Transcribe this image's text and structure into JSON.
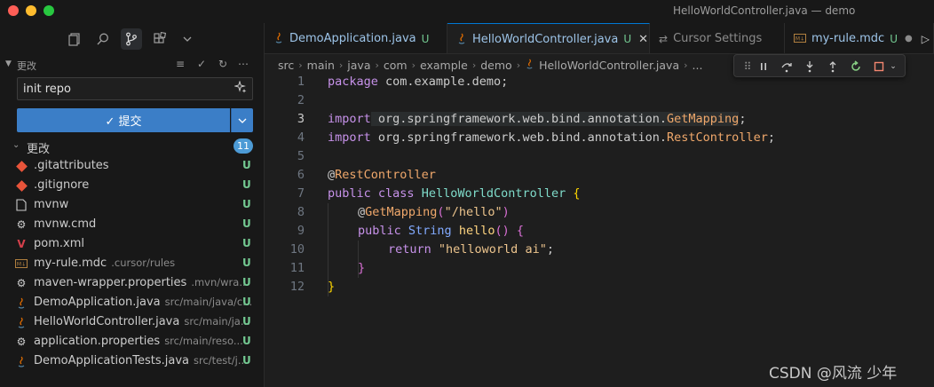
{
  "window": {
    "title": "HelloWorldController.java — demo"
  },
  "sidebar": {
    "section_title": "更改",
    "commit_message": "init repo",
    "commit_button": "✓ 提交",
    "changes_title": "更改",
    "changes_count": "11",
    "files": [
      {
        "name": ".gitattributes",
        "path": "",
        "status": "U",
        "icon": "git-icon"
      },
      {
        "name": ".gitignore",
        "path": "",
        "status": "U",
        "icon": "git-icon"
      },
      {
        "name": "mvnw",
        "path": "",
        "status": "U",
        "icon": "file-icon"
      },
      {
        "name": "mvnw.cmd",
        "path": "",
        "status": "U",
        "icon": "gear-icon"
      },
      {
        "name": "pom.xml",
        "path": "",
        "status": "U",
        "icon": "maven-icon"
      },
      {
        "name": "my-rule.mdc",
        "path": ".cursor/rules",
        "status": "U",
        "icon": "markdown-icon"
      },
      {
        "name": "maven-wrapper.properties",
        "path": ".mvn/wra...",
        "status": "U",
        "icon": "gear-icon"
      },
      {
        "name": "DemoApplication.java",
        "path": "src/main/java/c...",
        "status": "U",
        "icon": "java-icon"
      },
      {
        "name": "HelloWorldController.java",
        "path": "src/main/ja...",
        "status": "U",
        "icon": "java-icon"
      },
      {
        "name": "application.properties",
        "path": "src/main/reso...",
        "status": "U",
        "icon": "gear-icon"
      },
      {
        "name": "DemoApplicationTests.java",
        "path": "src/test/j...",
        "status": "U",
        "icon": "java-icon"
      }
    ]
  },
  "tabs": [
    {
      "label": "DemoApplication.java",
      "flag": "U",
      "icon": "java-icon"
    },
    {
      "label": "HelloWorldController.java",
      "flag": "U",
      "icon": "java-icon",
      "close": "✕"
    },
    {
      "label": "Cursor Settings",
      "flag": "",
      "icon": "settings-icon"
    },
    {
      "label": "my-rule.mdc",
      "flag": "U",
      "icon": "markdown-icon",
      "dot": "●"
    }
  ],
  "breadcrumb": [
    "src",
    "main",
    "java",
    "com",
    "example",
    "demo",
    "HelloWorldController.java",
    "..."
  ],
  "editor": {
    "lines": [
      {
        "n": "1"
      },
      {
        "n": "2"
      },
      {
        "n": "3"
      },
      {
        "n": "4"
      },
      {
        "n": "5"
      },
      {
        "n": "6"
      },
      {
        "n": "7"
      },
      {
        "n": "8"
      },
      {
        "n": "9"
      },
      {
        "n": "10"
      },
      {
        "n": "11"
      },
      {
        "n": "12"
      }
    ],
    "code": {
      "l1_kw": "package",
      "l1_rest": " com.example.demo;",
      "l3_kw": "import",
      "l3_pkg": " org.springframework.web.bind.annotation.",
      "l3_cls": "GetMapping",
      "l3_end": ";",
      "l4_kw": "import",
      "l4_pkg": " org.springframework.web.bind.annotation.",
      "l4_cls": "RestController",
      "l4_end": ";",
      "l6_at": "@",
      "l6_ann": "RestController",
      "l7_kw": "public",
      "l7_kw2": " class ",
      "l7_cls": "HelloWorldController",
      "l7_brace": " {",
      "l8_at": "@",
      "l8_ann": "GetMapping",
      "l8_open": "(",
      "l8_str": "\"/hello\"",
      "l8_close": ")",
      "l9_kw": "public",
      "l9_type": " String ",
      "l9_fn": "hello",
      "l9_paren": "()",
      "l9_brace": " {",
      "l10_kw": "return",
      "l10_str": " \"helloworld ai\"",
      "l10_end": ";",
      "l11_brace": "}",
      "l12_brace": "}"
    }
  },
  "watermark": "CSDN @风流 少年"
}
